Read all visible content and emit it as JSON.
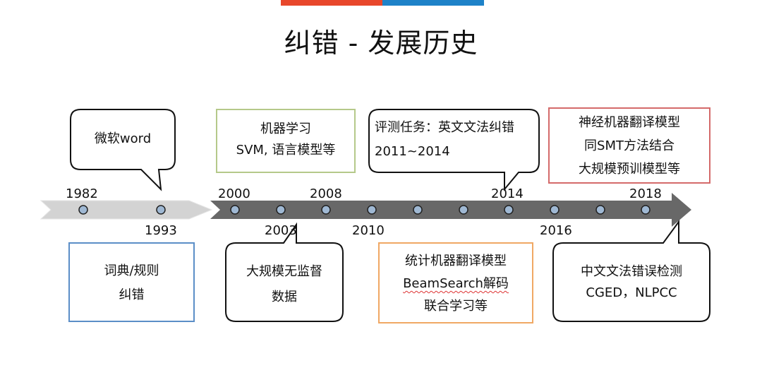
{
  "title": "纠错 - 发展历史",
  "colors": {
    "top_bar_left": "#e8472b",
    "top_bar_right": "#1e82c8",
    "arrow_light": "#d3d3d3",
    "arrow_dark": "#686868",
    "box_green": "#b5c98a",
    "box_red": "#d46a6a",
    "box_blue": "#5b8ec7",
    "box_orange": "#f0a864",
    "callout_border": "#111111"
  },
  "years": {
    "y1982": "1982",
    "y1993": "1993",
    "y2000": "2000",
    "y2003": "2003",
    "y2008": "2008",
    "y2010": "2010",
    "y2014": "2014",
    "y2016": "2016",
    "y2018": "2018"
  },
  "boxes": {
    "word": {
      "line1": "微软word"
    },
    "ml": {
      "line1": "机器学习",
      "line2": "SVM, 语言模型等"
    },
    "task": {
      "line1": "评测任务：英文文法纠错",
      "line2": "2011~2014"
    },
    "neural": {
      "line1": "神经机器翻译模型",
      "line2": "同SMT方法结合",
      "line3": "大规模预训模型等"
    },
    "dict": {
      "line1": "词典/规则",
      "line2": "纠错"
    },
    "unsup": {
      "line1": "大规模无监督",
      "line2": "数据"
    },
    "smt": {
      "line1": "统计机器翻译模型",
      "line2": "BeamSearch解码",
      "line3": "联合学习等"
    },
    "cged": {
      "line1": "中文文法错误检测",
      "line2": "CGED，NLPCC"
    }
  }
}
